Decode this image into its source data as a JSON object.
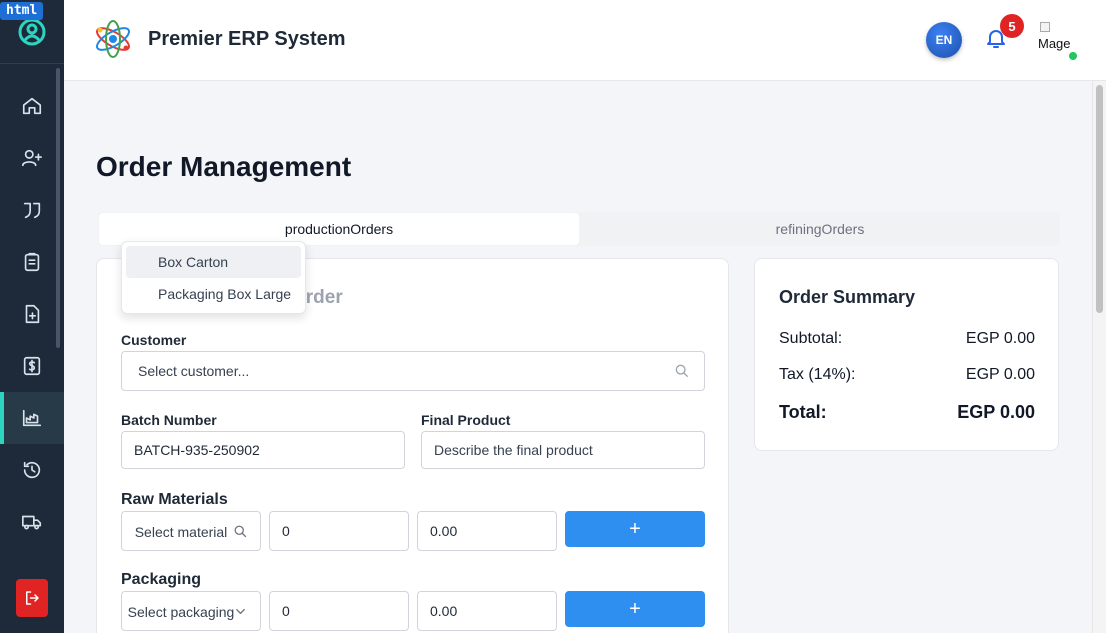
{
  "badge": "html",
  "header": {
    "title": "Premier ERP System",
    "lang": "EN",
    "notifications": "5",
    "avatar_alt": "Mage"
  },
  "sidebar": {
    "items": [
      {
        "icon": "home-icon"
      },
      {
        "icon": "add-user-icon"
      },
      {
        "icon": "quote-icon"
      },
      {
        "icon": "clipboard-icon"
      },
      {
        "icon": "file-plus-icon"
      },
      {
        "icon": "dollar-icon"
      },
      {
        "icon": "factory-icon",
        "active": true
      },
      {
        "icon": "history-icon"
      },
      {
        "icon": "truck-icon"
      }
    ],
    "logout_icon": "logout-icon"
  },
  "page": {
    "title": "Order Management",
    "tabs": [
      {
        "label": "productionOrders",
        "active": true
      },
      {
        "label": "refiningOrders",
        "active": false
      }
    ]
  },
  "form": {
    "title": "Create Production Order",
    "customer_label": "Customer",
    "customer_placeholder": "Select customer...",
    "batch_label": "Batch Number",
    "batch_value": "BATCH-935-250902",
    "final_label": "Final Product",
    "final_placeholder": "Describe the final product",
    "raw_label": "Raw Materials",
    "raw_select": "Select material",
    "raw_qty": "0",
    "raw_price": "0.00",
    "packaging_label": "Packaging",
    "pack_select": "Select packaging",
    "pack_qty": "0",
    "pack_price": "0.00",
    "add_label": "+"
  },
  "dropdown": {
    "items": [
      "Box Carton",
      "Packaging Box Large"
    ]
  },
  "summary": {
    "title": "Order Summary",
    "subtotal_label": "Subtotal:",
    "subtotal_value": "EGP 0.00",
    "tax_label": "Tax (14%):",
    "tax_value": "EGP 0.00",
    "total_label": "Total:",
    "total_value": "EGP 0.00"
  },
  "colors": {
    "sidebar": "#1e2a3a",
    "accent": "#2e8ff0",
    "active_marker": "#2dd4bf",
    "danger": "#e02424"
  }
}
